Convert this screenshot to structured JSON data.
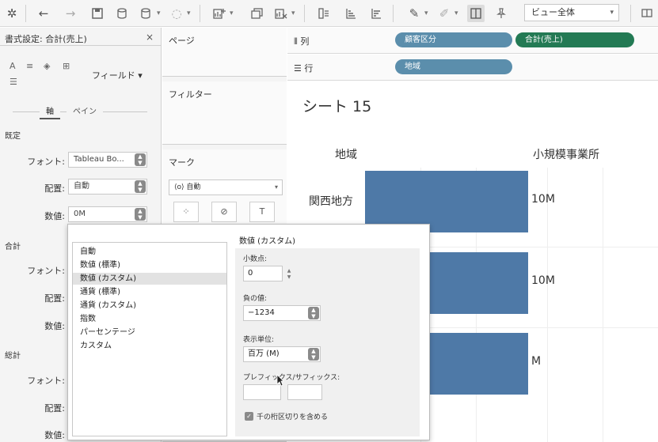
{
  "toolbar": {
    "view_mode": "ビュー全体"
  },
  "format_pane": {
    "title": "書式設定: 合計(売上)",
    "close": "×",
    "field_dropdown": "フィールド ▾",
    "tabs": [
      "軸",
      "ペイン"
    ],
    "sections": [
      {
        "title": "既定",
        "fields": [
          {
            "label": "フォント:",
            "value": "Tableau Bo..."
          },
          {
            "label": "配置:",
            "value": "自動"
          },
          {
            "label": "数値:",
            "value": "0M"
          }
        ]
      },
      {
        "title": "合計",
        "fields": [
          {
            "label": "フォント:"
          },
          {
            "label": "配置:"
          },
          {
            "label": "数値:"
          }
        ]
      },
      {
        "title": "総計",
        "fields": [
          {
            "label": "フォント:"
          },
          {
            "label": "配置:"
          },
          {
            "label": "数値:"
          }
        ]
      }
    ]
  },
  "cards": {
    "pages": "ページ",
    "filters": "フィルター",
    "marks": "マーク",
    "marks_type": "自動"
  },
  "shelves": {
    "columns_label": "列",
    "rows_label": "行",
    "column_pills": [
      "顧客区分",
      "合計(売上)"
    ],
    "row_pills": [
      "地域"
    ]
  },
  "view": {
    "sheet_title": "シート 15",
    "row_header": "地域",
    "column_header": "小規模事業所",
    "rows": [
      {
        "label": "関西地方",
        "value_label": "10M"
      },
      {
        "label": "",
        "value_label": "10M"
      },
      {
        "label": "",
        "value_label": "M"
      }
    ]
  },
  "chart_data": {
    "type": "bar",
    "categories": [
      "関西地方",
      "",
      ""
    ],
    "series": [
      {
        "name": "小規模事業所",
        "values": [
          10,
          10,
          10
        ]
      }
    ],
    "value_labels": [
      "10M",
      "10M",
      "M"
    ],
    "xlabel": "",
    "ylabel": "地域"
  },
  "dialog": {
    "list_items": [
      "自動",
      "数値 (標準)",
      "数値 (カスタム)",
      "通貨 (標準)",
      "通貨 (カスタム)",
      "指数",
      "パーセンテージ",
      "カスタム"
    ],
    "selected_index": 2,
    "options_title": "数値 (カスタム)",
    "decimal_label": "小数点:",
    "decimal_value": "0",
    "negative_label": "負の値:",
    "negative_value": "−1234",
    "units_label": "表示単位:",
    "units_value": "百万 (M)",
    "prefix_suffix_label": "プレフィックス/サフィックス:",
    "prefix_value": "",
    "suffix_value": "",
    "thousands_separator_label": "千の桁区切りを含める",
    "thousands_separator_checked": true
  }
}
